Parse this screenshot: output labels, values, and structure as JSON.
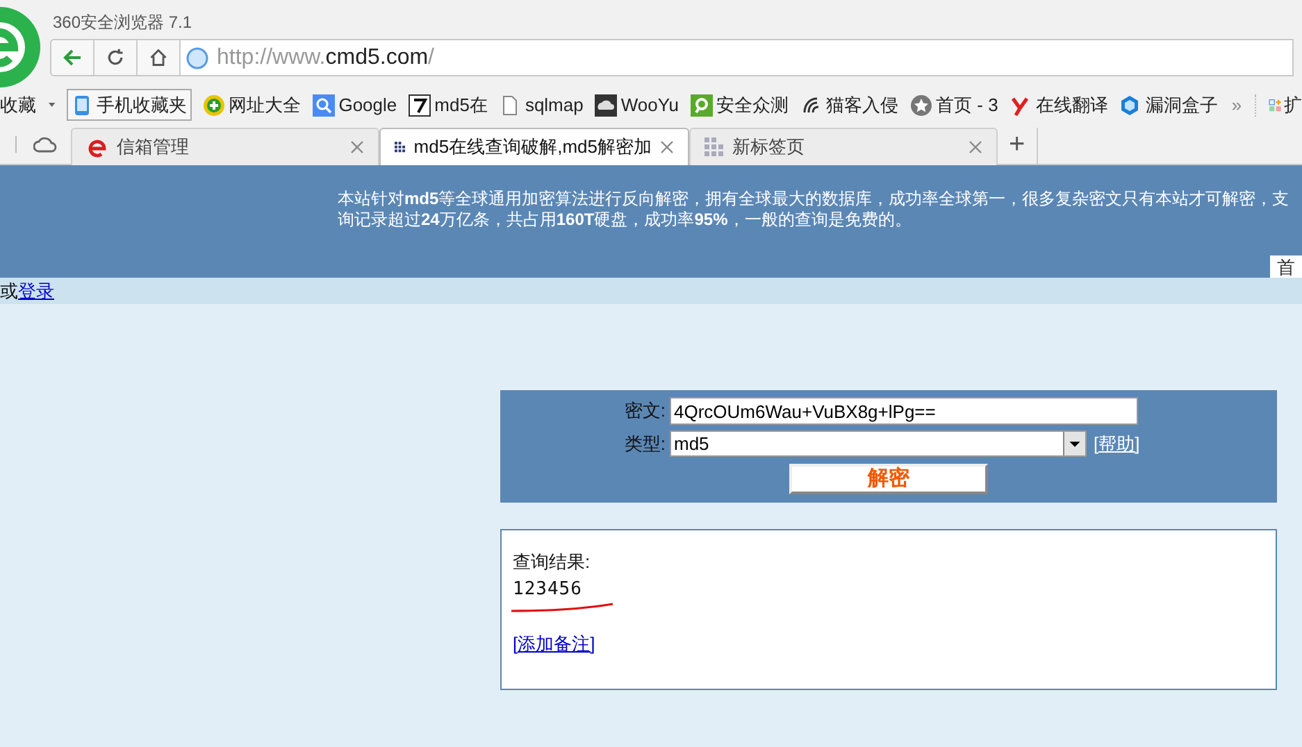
{
  "window": {
    "title": "360安全浏览器 7.1"
  },
  "address_bar": {
    "url_prefix": "http://www.",
    "url_domain": "cmd5.com",
    "url_suffix": "/"
  },
  "bookmarks": {
    "folder": "收藏",
    "items": [
      {
        "label": "手机收藏夹"
      },
      {
        "label": "网址大全"
      },
      {
        "label": "Google"
      },
      {
        "label": "md5在"
      },
      {
        "label": "sqlmap"
      },
      {
        "label": "WooYu"
      },
      {
        "label": "安全众测"
      },
      {
        "label": "猫客入侵"
      },
      {
        "label": "首页 - 3"
      },
      {
        "label": "在线翻译"
      },
      {
        "label": "漏洞盒子"
      }
    ],
    "more": "»",
    "extension": "扩"
  },
  "tabs": [
    {
      "label": "信箱管理",
      "selected": false
    },
    {
      "label": "md5在线查询破解,md5解密加",
      "selected": true
    },
    {
      "label": "新标签页",
      "selected": false
    }
  ],
  "new_tab": "+",
  "banner": {
    "lines": [
      "本站针对**md5**等全球通用加密算法进行反向解密，拥有全球最大的数据库，成功率全球第一，很多复杂密文只有本站才可解密，支",
      "询记录超过**24**万亿条，共占用**160T**硬盘，成功率**95%**，一般的查询是免费的。"
    ],
    "home_button": "首"
  },
  "login_bar": {
    "text": "或",
    "link": "登录"
  },
  "form": {
    "ciphertext_label": "密文:",
    "ciphertext_value": "4QrcOUm6Wau+VuBX8g+lPg==",
    "type_label": "类型:",
    "type_value": "md5",
    "help_link": "[帮助]",
    "submit": "解密"
  },
  "result": {
    "title": "查询结果:",
    "value": "123456",
    "add_note_link": "[添加备注]"
  }
}
